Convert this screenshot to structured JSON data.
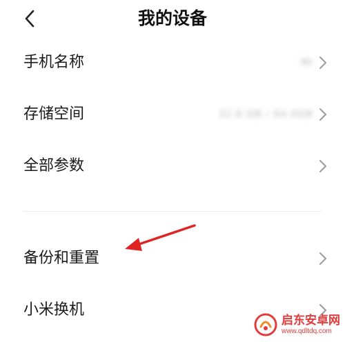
{
  "header": {
    "title": "我的设备"
  },
  "rows": [
    {
      "label": "手机名称",
      "value": "Mi"
    },
    {
      "label": "存储空间",
      "value": "32.8 GB / 64.0GB"
    },
    {
      "label": "全部参数",
      "value": ""
    },
    {
      "label": "备份和重置",
      "value": ""
    },
    {
      "label": "小米换机",
      "value": ""
    }
  ],
  "watermark": {
    "name": "启东安卓网",
    "url": "www.qdltdq.com"
  },
  "colors": {
    "annotation_arrow": "#e02424",
    "chevron": "#9a9a9a",
    "watermark": "#e23b3b"
  },
  "icons": {
    "back": "chevron-left-icon",
    "row_chevron": "chevron-right-icon"
  }
}
